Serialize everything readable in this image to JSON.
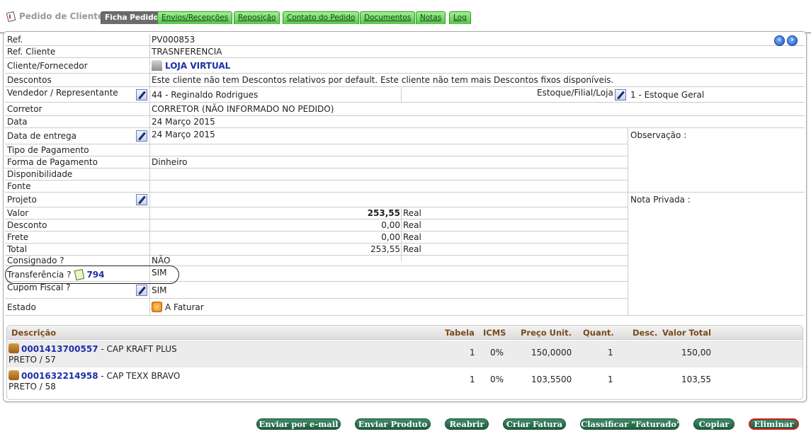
{
  "tabs": {
    "title": "Pedido de Cliente",
    "items": [
      {
        "label": "Ficha Pedido",
        "active": true
      },
      {
        "label": "Envios/Recepções"
      },
      {
        "label": "Reposição"
      },
      {
        "label": "Contato do Pedido"
      },
      {
        "label": "Documentos"
      },
      {
        "label": "Notas"
      },
      {
        "label": "Log"
      }
    ]
  },
  "order": {
    "ref_label": "Ref.",
    "ref_value": "PV000853",
    "ref_cliente_label": "Ref. Cliente",
    "ref_cliente_value": "TRASNFERENCIA",
    "cliente_label": "Cliente/Fornecedor",
    "cliente_value": "LOJA VIRTUAL",
    "descontos_label": "Descontos",
    "descontos_value": "Este cliente não tem Descontos relativos por default. Este cliente não tem mais Descontos fixos disponíveis.",
    "vendedor_label": "Vendedor / Representante",
    "vendedor_value": "44 - Reginaldo Rodrigues",
    "estoque_label": "Estoque/Filial/Loja",
    "estoque_value": "1 - Estoque Geral",
    "corretor_label": "Corretor",
    "corretor_value": "CORRETOR (NÃO INFORMADO NO PEDIDO)",
    "data_label": "Data",
    "data_value": "24 Março 2015",
    "entrega_label": "Data de entrega",
    "entrega_value": "24 Março 2015",
    "observacao_label": "Observação :",
    "tipo_pagamento_label": "Tipo de Pagamento",
    "tipo_pagamento_value": "",
    "forma_pagamento_label": "Forma de Pagamento",
    "forma_pagamento_value": "Dinheiro",
    "disponibilidade_label": "Disponibilidade",
    "fonte_label": "Fonte",
    "projeto_label": "Projeto",
    "nota_privada_label": "Nota Privada :",
    "valor_label": "Valor",
    "valor_value": "253,55",
    "valor_currency": "Real",
    "desconto_label": "Desconto",
    "desconto_value": "0,00",
    "desconto_currency": "Real",
    "frete_label": "Frete",
    "frete_value": "0,00",
    "frete_currency": "Real",
    "total_label": "Total",
    "total_value": "253,55",
    "total_currency": "Real",
    "consignado_label": "Consignado ?",
    "consignado_value": "NÃO",
    "transferencia_label": "Transferência ?",
    "transferencia_link": "794",
    "transferencia_value": "SIM",
    "cupom_label": "Cupom Fiscal ?",
    "cupom_value": "SIM",
    "estado_label": "Estado",
    "estado_value": "A Faturar"
  },
  "items": {
    "headers": {
      "descricao": "Descrição",
      "tabela": "Tabela",
      "icms": "ICMS",
      "preco": "Preço Unit.",
      "quant": "Quant.",
      "desc": "Desc.",
      "total": "Valor Total"
    },
    "rows": [
      {
        "code": "0001413700557",
        "name": " - CAP KRAFT PLUS",
        "variant": "PRETO / 57",
        "tabela": "1",
        "icms": "0%",
        "preco": "150,0000",
        "quant": "1",
        "total": "150,00"
      },
      {
        "code": "0001632214958",
        "name": " - CAP TEXX BRAVO",
        "variant": "PRETO / 58",
        "tabela": "1",
        "icms": "0%",
        "preco": "103,5500",
        "quant": "1",
        "total": "103,55"
      }
    ]
  },
  "actions": {
    "email": "Enviar por e-mail",
    "enviar_produto": "Enviar Produto",
    "reabrir": "Reabrir",
    "criar_fatura": "Criar Fatura",
    "classificar": "Classificar \"Faturado\"",
    "copiar": "Copiar",
    "eliminar": "Eliminar"
  },
  "colors": {
    "tab_green": "#55c64a",
    "button_green": "#2a7352",
    "link_blue": "#1c2fa8",
    "danger": "#c81d1d"
  }
}
